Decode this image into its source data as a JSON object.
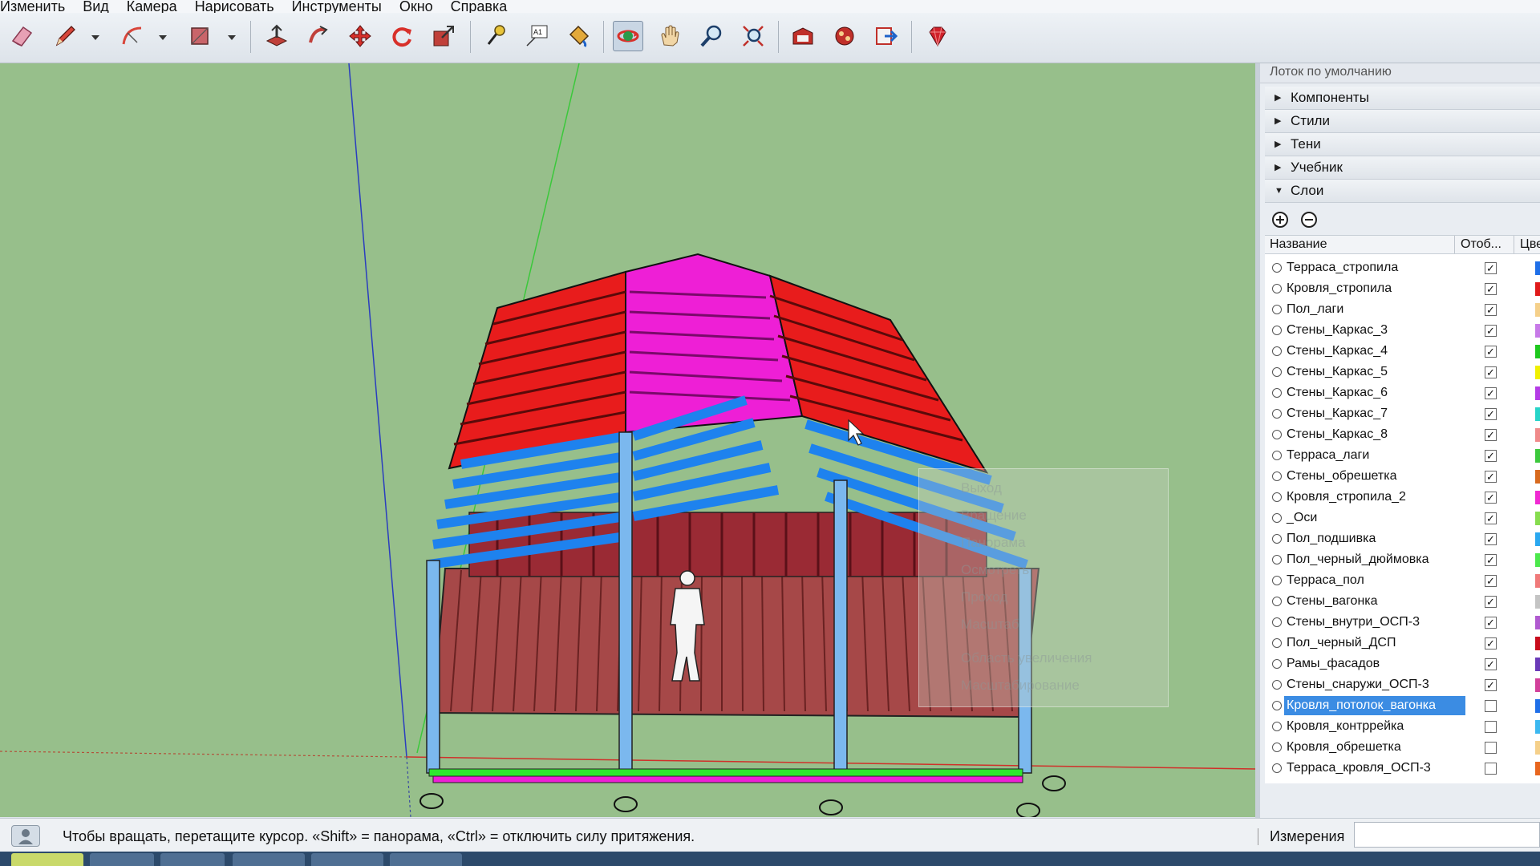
{
  "menu": [
    "Изменить",
    "Вид",
    "Камера",
    "Нарисовать",
    "Инструменты",
    "Окно",
    "Справка"
  ],
  "toolbar": {
    "icons": [
      "eraser-icon",
      "pencil-icon",
      "arc-icon",
      "rectangle-icon",
      "push-pull-icon",
      "follow-me-icon",
      "move-icon",
      "rotate-icon",
      "scale-icon",
      "tape-measure-icon",
      "text-icon",
      "paint-bucket-icon",
      "orbit-icon",
      "pan-icon",
      "zoom-icon",
      "zoom-extents-icon",
      "warehouse-icon",
      "extension-icon",
      "send-to-layout-icon",
      "ruby-icon"
    ],
    "active_tool": "orbit-icon"
  },
  "context_menu": {
    "items": [
      "Выход",
      "Вращение",
      "Панорама",
      "Осмотреть",
      "Проход",
      "Масштаб",
      "Область увеличения",
      "Масштабирование"
    ]
  },
  "tray": {
    "title": "Лоток по умолчанию",
    "panels": [
      {
        "label": "Компоненты",
        "expanded": false
      },
      {
        "label": "Стили",
        "expanded": false
      },
      {
        "label": "Тени",
        "expanded": false
      },
      {
        "label": "Учебник",
        "expanded": false
      },
      {
        "label": "Слои",
        "expanded": true
      }
    ],
    "layers": {
      "columns": {
        "name": "Название",
        "visible": "Отоб...",
        "color": "Цве"
      },
      "rows": [
        {
          "name": "Терраса_стропила",
          "visible": true,
          "color": "#1f6fe8"
        },
        {
          "name": "Кровля_стропила",
          "visible": true,
          "color": "#e01a1a"
        },
        {
          "name": "Пол_лаги",
          "visible": true,
          "color": "#f5d08a"
        },
        {
          "name": "Стены_Каркас_3",
          "visible": true,
          "color": "#c77ae8"
        },
        {
          "name": "Стены_Каркас_4",
          "visible": true,
          "color": "#1ec81e"
        },
        {
          "name": "Стены_Каркас_5",
          "visible": true,
          "color": "#f0f000"
        },
        {
          "name": "Стены_Каркас_6",
          "visible": true,
          "color": "#b43ce6"
        },
        {
          "name": "Стены_Каркас_7",
          "visible": true,
          "color": "#27d4c8"
        },
        {
          "name": "Стены_Каркас_8",
          "visible": true,
          "color": "#f08a8a"
        },
        {
          "name": "Терраса_лаги",
          "visible": true,
          "color": "#3cc83c"
        },
        {
          "name": "Стены_обрешетка",
          "visible": true,
          "color": "#d86a1e"
        },
        {
          "name": "Кровля_стропила_2",
          "visible": true,
          "color": "#f02ad2"
        },
        {
          "name": "_Оси",
          "visible": true,
          "color": "#86dc4e"
        },
        {
          "name": "Пол_подшивка",
          "visible": true,
          "color": "#2aa8f0"
        },
        {
          "name": "Пол_черный_дюймовка",
          "visible": true,
          "color": "#4ce84c"
        },
        {
          "name": "Терраса_пол",
          "visible": true,
          "color": "#f07a7a"
        },
        {
          "name": "Стены_вагонка",
          "visible": true,
          "color": "#c4c4c4"
        },
        {
          "name": "Стены_внутри_ОСП-3",
          "visible": true,
          "color": "#b05ad0"
        },
        {
          "name": "Пол_черный_ДСП",
          "visible": true,
          "color": "#c80c1c"
        },
        {
          "name": "Рамы_фасадов",
          "visible": true,
          "color": "#6a3ab8"
        },
        {
          "name": "Стены_снаружи_ОСП-3",
          "visible": true,
          "color": "#d2409a"
        },
        {
          "name": "Кровля_потолок_вагонка",
          "visible": false,
          "color": "#1f6fe8",
          "selected": true
        },
        {
          "name": "Кровля_контррейка",
          "visible": false,
          "color": "#3cb8f0"
        },
        {
          "name": "Кровля_обрешетка",
          "visible": false,
          "color": "#f5d08a"
        },
        {
          "name": "Терраса_кровля_ОСП-3",
          "visible": false,
          "color": "#e8661e"
        }
      ]
    }
  },
  "status": {
    "text": "Чтобы вращать, перетащите курсор. «Shift» = панорама, «Ctrl» = отключить силу притяжения.",
    "measurements_label": "Измерения",
    "measurements_value": ""
  }
}
